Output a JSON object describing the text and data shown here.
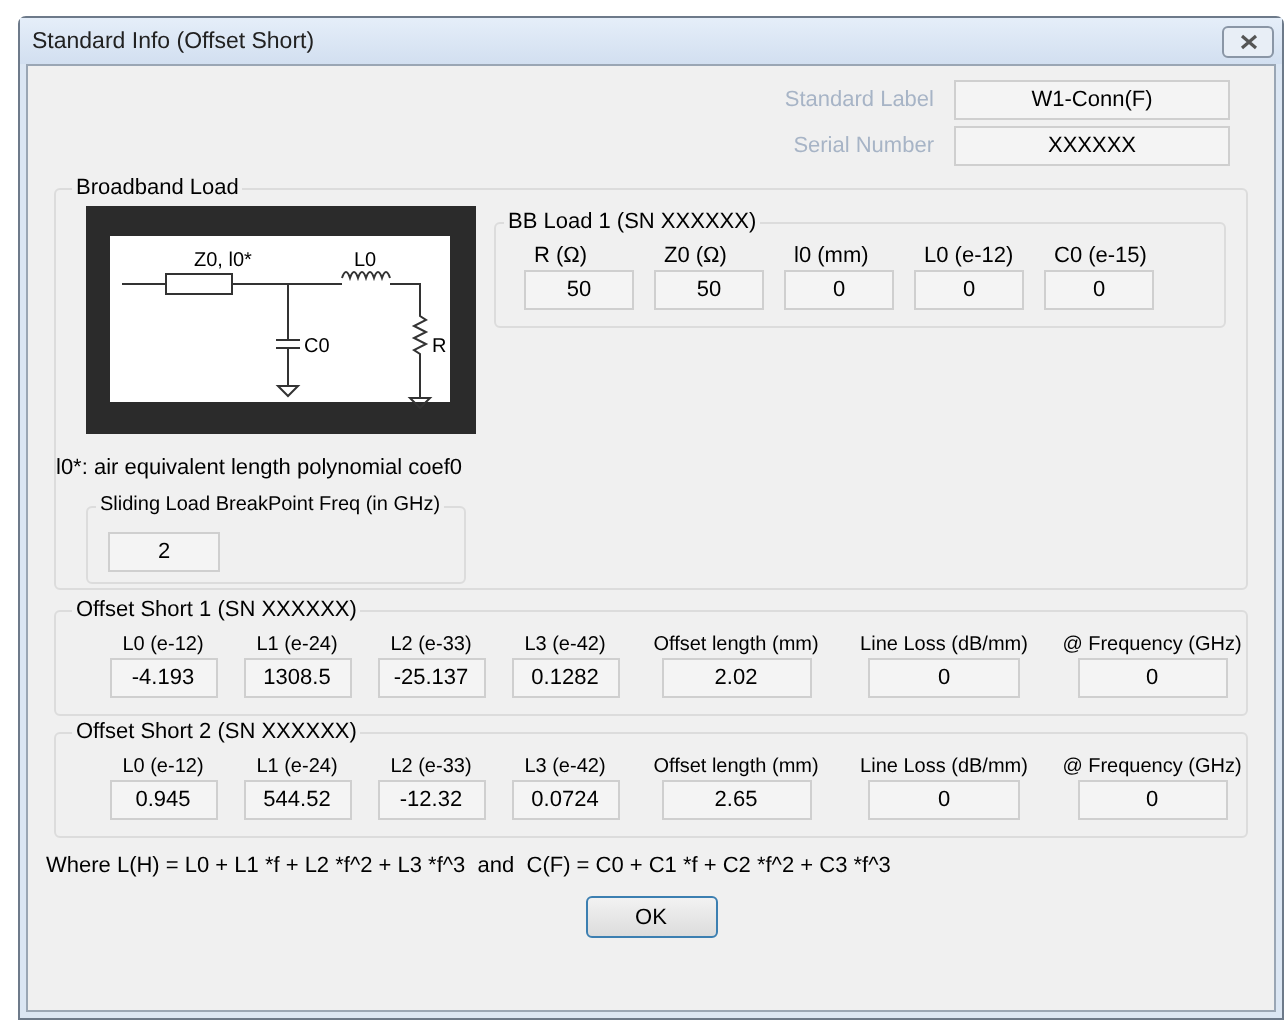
{
  "window": {
    "title": "Standard Info (Offset Short)"
  },
  "header_fields": [
    {
      "label": "Standard Label",
      "value": "W1-Conn(F)",
      "disabled": true
    },
    {
      "label": "Serial Number",
      "value": "XXXXXX",
      "disabled": true
    }
  ],
  "broadband_load": {
    "title": "Broadband Load",
    "diagram_labels": {
      "line": "Z0, l0*",
      "inductor": "L0",
      "capacitor": "C0",
      "resistor": "R"
    },
    "bb_load": {
      "title": "BB Load 1 (SN XXXXXX)",
      "fields": [
        {
          "label": "R (Ω)",
          "value": "50"
        },
        {
          "label": "Z0 (Ω)",
          "value": "50"
        },
        {
          "label": "l0 (mm)",
          "value": "0"
        },
        {
          "label": "L0 (e-12)",
          "value": "0"
        },
        {
          "label": "C0 (e-15)",
          "value": "0"
        }
      ]
    },
    "note": "l0*: air equivalent length polynomial coef0",
    "sliding": {
      "title": "Sliding Load BreakPoint Freq (in GHz)",
      "value": "2"
    }
  },
  "offset_shorts": [
    {
      "title": "Offset Short 1 (SN XXXXXX)",
      "fields": [
        {
          "label": "L0 (e-12)",
          "value": "-4.193"
        },
        {
          "label": "L1 (e-24)",
          "value": "1308.5"
        },
        {
          "label": "L2 (e-33)",
          "value": "-25.137"
        },
        {
          "label": "L3 (e-42)",
          "value": "0.1282"
        },
        {
          "label": "Offset length (mm)",
          "value": "2.02"
        },
        {
          "label": "Line Loss (dB/mm)",
          "value": "0"
        },
        {
          "label": "@ Frequency (GHz)",
          "value": "0"
        }
      ]
    },
    {
      "title": "Offset Short 2 (SN XXXXXX)",
      "fields": [
        {
          "label": "L0 (e-12)",
          "value": "0.945"
        },
        {
          "label": "L1 (e-24)",
          "value": "544.52"
        },
        {
          "label": "L2 (e-33)",
          "value": "-12.32"
        },
        {
          "label": "L3 (e-42)",
          "value": "0.0724"
        },
        {
          "label": "Offset length (mm)",
          "value": "2.65"
        },
        {
          "label": "Line Loss (dB/mm)",
          "value": "0"
        },
        {
          "label": "@ Frequency (GHz)",
          "value": "0"
        }
      ]
    }
  ],
  "formula": "Where L(H) = L0 + L1 *f + L2 *f^2 + L3 *f^3  and  C(F) = C0 + C1 *f + C2 *f^2 + C3 *f^3",
  "buttons": [
    "OK"
  ]
}
